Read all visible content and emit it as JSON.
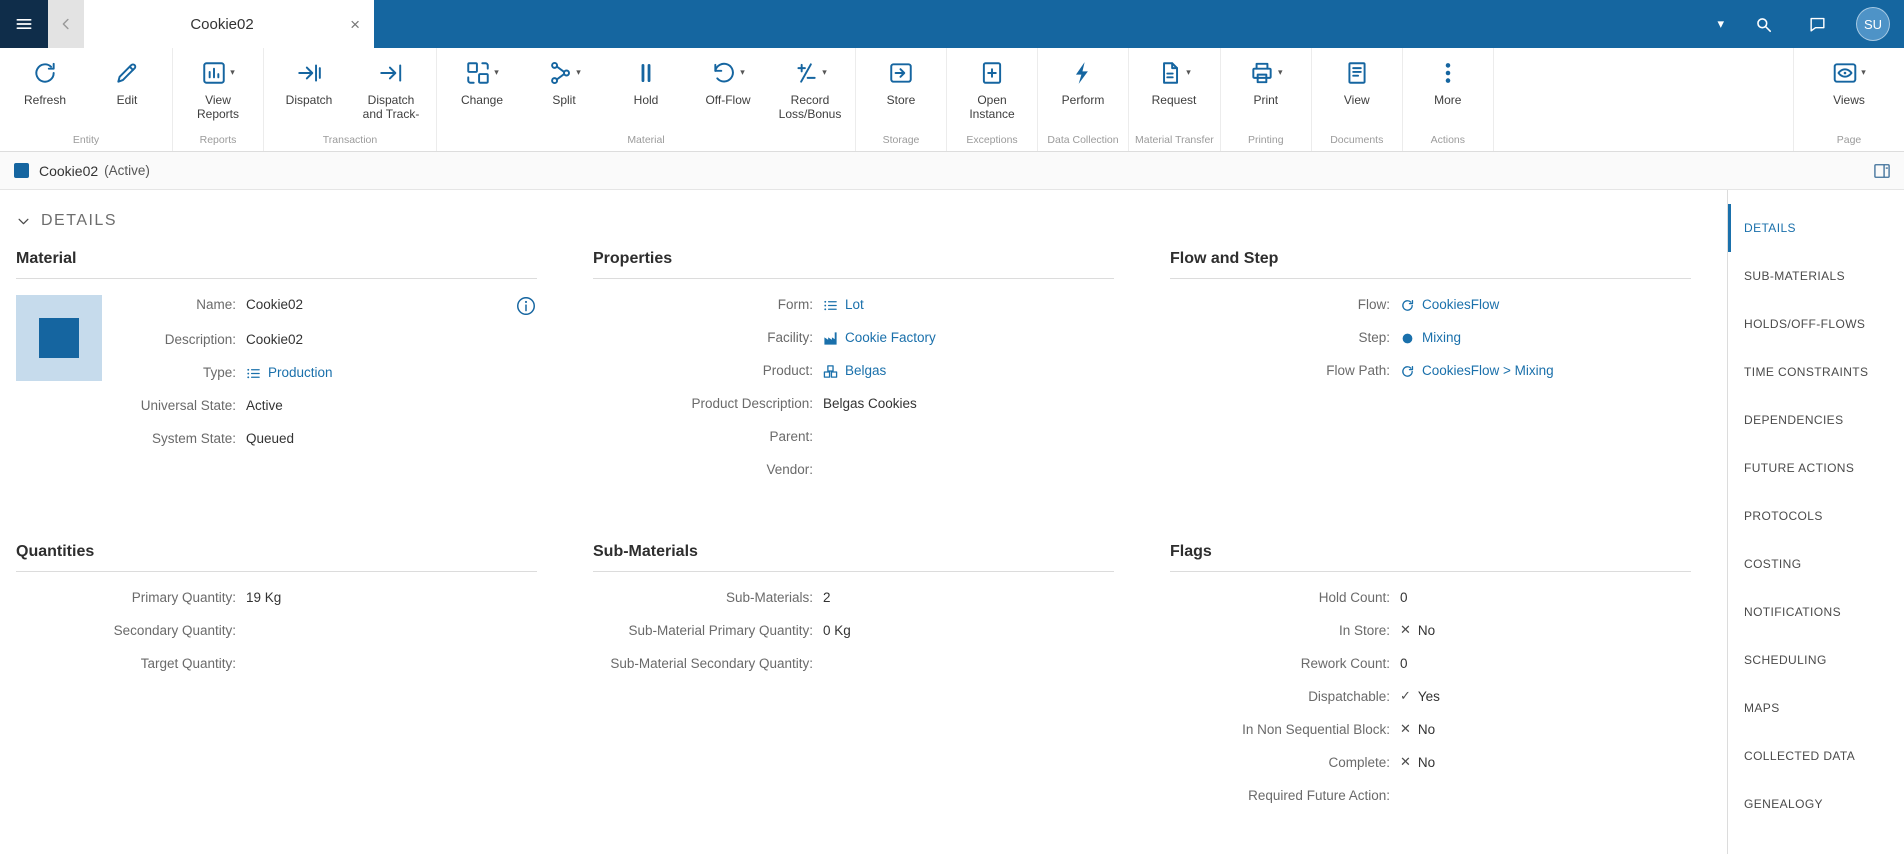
{
  "glyphs": {
    "caret_down": "▾",
    "x_mark": "✕",
    "check_mark": "✓"
  },
  "topbar": {
    "tab_title": "Cookie02",
    "close_glyph": "×",
    "avatar": "SU"
  },
  "toolbar": {
    "groups": [
      {
        "label": "Entity",
        "buttons": [
          {
            "label": "Refresh",
            "icon": "refresh-icon"
          },
          {
            "label": "Edit",
            "icon": "edit-icon"
          }
        ]
      },
      {
        "label": "Reports",
        "buttons": [
          {
            "label": "View Reports",
            "icon": "view-reports-icon",
            "caret": true
          }
        ]
      },
      {
        "label": "Transaction",
        "buttons": [
          {
            "label": "Dispatch",
            "icon": "dispatch-icon"
          },
          {
            "label": "Dispatch and Track-",
            "icon": "dispatch-track-icon"
          }
        ]
      },
      {
        "label": "Material",
        "buttons": [
          {
            "label": "Change",
            "icon": "change-icon",
            "caret": true
          },
          {
            "label": "Split",
            "icon": "split-icon",
            "caret": true
          },
          {
            "label": "Hold",
            "icon": "hold-icon"
          },
          {
            "label": "Off-Flow",
            "icon": "off-flow-icon",
            "caret": true
          },
          {
            "label": "Record Loss/Bonus",
            "icon": "record-loss-bonus-icon",
            "caret": true
          }
        ]
      },
      {
        "label": "Storage",
        "buttons": [
          {
            "label": "Store",
            "icon": "store-icon"
          }
        ]
      },
      {
        "label": "Exceptions",
        "buttons": [
          {
            "label": "Open Instance",
            "icon": "open-instance-icon"
          }
        ]
      },
      {
        "label": "Data Collection",
        "buttons": [
          {
            "label": "Perform",
            "icon": "perform-icon"
          }
        ]
      },
      {
        "label": "Material Transfer",
        "buttons": [
          {
            "label": "Request",
            "icon": "request-icon",
            "caret": true
          }
        ]
      },
      {
        "label": "Printing",
        "buttons": [
          {
            "label": "Print",
            "icon": "print-icon",
            "caret": true
          }
        ]
      },
      {
        "label": "Documents",
        "buttons": [
          {
            "label": "View",
            "icon": "view-documents-icon"
          }
        ]
      },
      {
        "label": "Actions",
        "buttons": [
          {
            "label": "More",
            "icon": "more-icon"
          }
        ]
      },
      {
        "label": "Page",
        "right": true,
        "buttons": [
          {
            "label": "Views",
            "icon": "views-icon",
            "caret": true
          }
        ]
      }
    ]
  },
  "entity_header": {
    "title": "Cookie02",
    "state": "(Active)"
  },
  "details": {
    "section_title": "DETAILS",
    "panels": [
      {
        "id": "material",
        "title": "Material",
        "thumbnail": true,
        "fields": [
          {
            "label": "Name:",
            "value": "Cookie02",
            "info": true
          },
          {
            "label": "Description:",
            "value": "Cookie02"
          },
          {
            "label": "Type:",
            "value": "Production",
            "link": true,
            "icon": "list-icon"
          },
          {
            "label": "Universal State:",
            "value": "Active"
          },
          {
            "label": "System State:",
            "value": "Queued"
          }
        ]
      },
      {
        "id": "properties",
        "title": "Properties",
        "fields": [
          {
            "label": "Form:",
            "value": "Lot",
            "link": true,
            "icon": "list-icon"
          },
          {
            "label": "Facility:",
            "value": "Cookie Factory",
            "link": true,
            "icon": "factory-icon"
          },
          {
            "label": "Product:",
            "value": "Belgas",
            "link": true,
            "icon": "product-icon"
          },
          {
            "label": "Product Description:",
            "value": "Belgas Cookies"
          },
          {
            "label": "Parent:",
            "value": ""
          },
          {
            "label": "Vendor:",
            "value": ""
          }
        ]
      },
      {
        "id": "flow-and-step",
        "title": "Flow and Step",
        "fields": [
          {
            "label": "Flow:",
            "value": "CookiesFlow",
            "link": true,
            "icon": "flow-icon"
          },
          {
            "label": "Step:",
            "value": "Mixing",
            "link": true,
            "icon": "step-icon"
          },
          {
            "label": "Flow Path:",
            "value": "CookiesFlow > Mixing",
            "link": true,
            "icon": "flow-icon"
          }
        ]
      },
      {
        "id": "quantities",
        "title": "Quantities",
        "fields": [
          {
            "label": "Primary Quantity:",
            "value": "19 Kg"
          },
          {
            "label": "Secondary Quantity:",
            "value": ""
          },
          {
            "label": "Target Quantity:",
            "value": ""
          }
        ]
      },
      {
        "id": "sub-materials",
        "title": "Sub-Materials",
        "fields": [
          {
            "label": "Sub-Materials:",
            "value": "2"
          },
          {
            "label": "Sub-Material Primary Quantity:",
            "value": "0 Kg"
          },
          {
            "label": "Sub-Material Secondary Quantity:",
            "value": ""
          }
        ]
      },
      {
        "id": "flags",
        "title": "Flags",
        "fields": [
          {
            "label": "Hold Count:",
            "value": "0"
          },
          {
            "label": "In Store:",
            "value": "No",
            "mark": "x"
          },
          {
            "label": "Rework Count:",
            "value": "0"
          },
          {
            "label": "Dispatchable:",
            "value": "Yes",
            "mark": "check"
          },
          {
            "label": "In Non Sequential Block:",
            "value": "No",
            "mark": "x"
          },
          {
            "label": "Complete:",
            "value": "No",
            "mark": "x"
          },
          {
            "label": "Required Future Action:",
            "value": ""
          }
        ]
      }
    ]
  },
  "sidebar": {
    "items": [
      {
        "label": "DETAILS",
        "active": true
      },
      {
        "label": "SUB-MATERIALS"
      },
      {
        "label": "HOLDS/OFF-FLOWS"
      },
      {
        "label": "TIME CONSTRAINTS"
      },
      {
        "label": "DEPENDENCIES"
      },
      {
        "label": "FUTURE ACTIONS"
      },
      {
        "label": "PROTOCOLS"
      },
      {
        "label": "COSTING"
      },
      {
        "label": "NOTIFICATIONS"
      },
      {
        "label": "SCHEDULING"
      },
      {
        "label": "MAPS"
      },
      {
        "label": "COLLECTED DATA"
      },
      {
        "label": "GENEALOGY"
      }
    ]
  }
}
